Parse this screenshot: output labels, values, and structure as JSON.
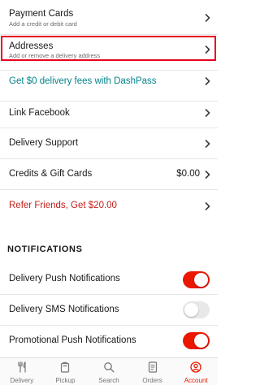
{
  "colors": {
    "accent": "#eb1700",
    "dashpass": "#00838a",
    "highlight_box": "#e8001c",
    "toggle_off": "#e8e8e8"
  },
  "rows": {
    "payment_cards": {
      "title": "Payment Cards",
      "subtitle": "Add a credit or debit card"
    },
    "addresses": {
      "title": "Addresses",
      "subtitle": "Add or remove a delivery address"
    },
    "dashpass": {
      "title": "Get $0 delivery fees with DashPass"
    },
    "link_facebook": {
      "title": "Link Facebook"
    },
    "delivery_support": {
      "title": "Delivery Support"
    },
    "credits": {
      "title": "Credits & Gift Cards",
      "value": "$0.00"
    },
    "refer": {
      "title": "Refer Friends, Get $20.00"
    }
  },
  "notifications": {
    "header": "NOTIFICATIONS",
    "items": [
      {
        "label": "Delivery Push Notifications",
        "enabled": true
      },
      {
        "label": "Delivery SMS Notifications",
        "enabled": false
      },
      {
        "label": "Promotional Push Notifications",
        "enabled": true
      }
    ]
  },
  "tabbar": {
    "items": [
      {
        "label": "Delivery",
        "icon": "fork-knife-icon"
      },
      {
        "label": "Pickup",
        "icon": "bag-icon"
      },
      {
        "label": "Search",
        "icon": "search-icon"
      },
      {
        "label": "Orders",
        "icon": "receipt-icon"
      },
      {
        "label": "Account",
        "icon": "account-icon",
        "active": true
      }
    ]
  }
}
